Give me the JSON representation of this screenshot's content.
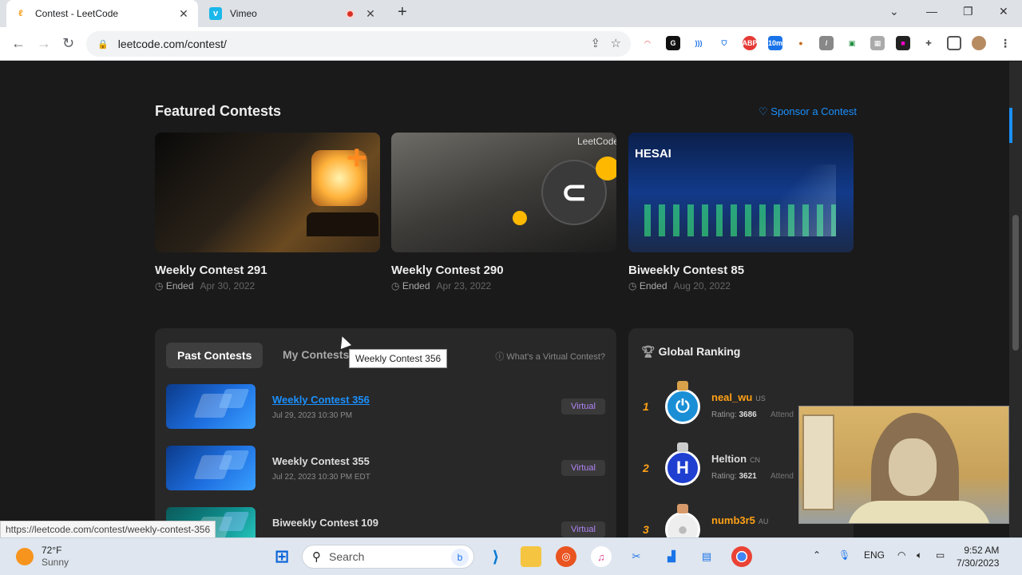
{
  "browser": {
    "tabs": [
      {
        "title": "Contest - LeetCode",
        "active": true
      },
      {
        "title": "Vimeo",
        "active": false
      }
    ],
    "url": "leetcode.com/contest/",
    "status_url": "https://leetcode.com/contest/weekly-contest-356",
    "extension_badge": "10m"
  },
  "featured": {
    "title": "Featured Contests",
    "sponsor_link": "Sponsor a Contest",
    "cards": [
      {
        "name": "Weekly Contest 291",
        "status": "Ended",
        "date": "Apr 30, 2022"
      },
      {
        "name": "Weekly Contest 290",
        "status": "Ended",
        "date": "Apr 23, 2022",
        "brand": "LeetCode"
      },
      {
        "name": "Biweekly Contest 85",
        "status": "Ended",
        "date": "Aug 20, 2022",
        "brand": "HESAI"
      }
    ]
  },
  "past": {
    "tab_active": "Past Contests",
    "tab_other": "My Contests",
    "help": "What's a Virtual Contest?",
    "rows": [
      {
        "name": "Weekly Contest 356",
        "date": "Jul 29, 2023 10:30 PM",
        "badge": "Virtual"
      },
      {
        "name": "Weekly Contest 355",
        "date": "Jul 22, 2023 10:30 PM EDT",
        "badge": "Virtual"
      },
      {
        "name": "Biweekly Contest 109",
        "date": "",
        "badge": "Virtual"
      }
    ],
    "tooltip": "Weekly Contest 356"
  },
  "ranking": {
    "title": "Global Ranking",
    "users": [
      {
        "rank": "1",
        "name": "neal_wu",
        "country": "US",
        "rating_label": "Rating:",
        "rating": "3686",
        "attended": "Attend"
      },
      {
        "rank": "2",
        "name": "Heltion",
        "country": "CN",
        "rating_label": "Rating:",
        "rating": "3621",
        "attended": "Attend"
      },
      {
        "rank": "3",
        "name": "numb3r5",
        "country": "AU",
        "rating_label": "",
        "rating": "",
        "attended": ""
      }
    ]
  },
  "taskbar": {
    "temp": "72°F",
    "condition": "Sunny",
    "search": "Search",
    "lang": "ENG",
    "time": "9:52 AM",
    "date": "7/30/2023"
  },
  "colors": {
    "accent": "#1a90ff",
    "orange": "#ffa116",
    "virtual": "#b084f5"
  }
}
